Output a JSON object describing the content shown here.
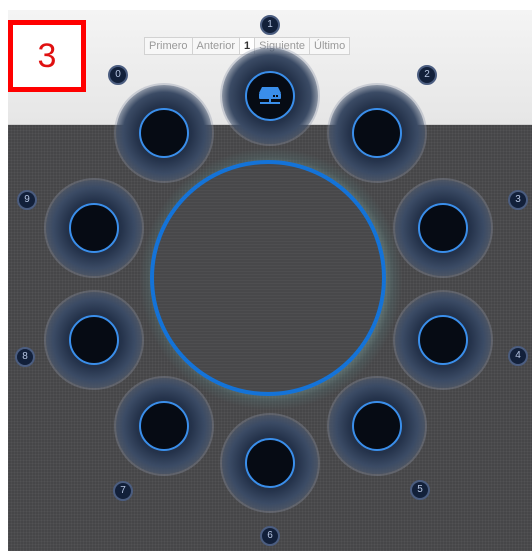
{
  "pagination": {
    "first": "Primero",
    "previous": "Anterior",
    "current": "1",
    "next": "Siguiente",
    "last": "Último"
  },
  "step_badge": "3",
  "slots": [
    {
      "number": "0",
      "has_device": false
    },
    {
      "number": "1",
      "has_device": true,
      "icon": "server-icon"
    },
    {
      "number": "2",
      "has_device": false
    },
    {
      "number": "3",
      "has_device": false
    },
    {
      "number": "4",
      "has_device": false
    },
    {
      "number": "5",
      "has_device": false
    },
    {
      "number": "6",
      "has_device": false
    },
    {
      "number": "7",
      "has_device": false
    },
    {
      "number": "8",
      "has_device": false
    },
    {
      "number": "9",
      "has_device": false
    }
  ],
  "colors": {
    "accent": "#1473d8",
    "badge_border": "#ff0000"
  }
}
